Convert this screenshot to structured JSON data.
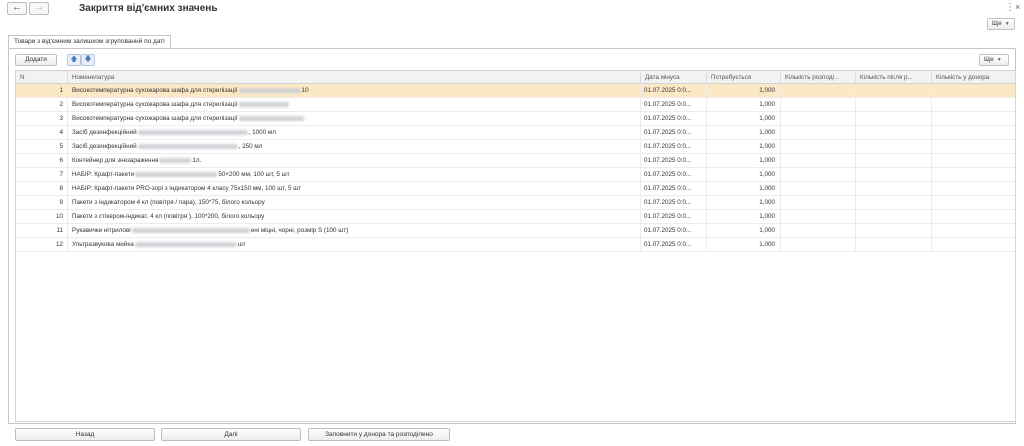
{
  "window": {
    "title": "Закриття від'ємних значень",
    "back_icon": "←",
    "forward_icon": "→",
    "kebab_icon": "⋮",
    "close_icon": "×"
  },
  "toolbar": {
    "more_label": "Ще"
  },
  "tab": {
    "label": "Товари з від'ємним залишком згрупований по даті"
  },
  "table_toolbar": {
    "add_label": "Додати",
    "up_icon": "🡅",
    "down_icon": "🡇",
    "more_label": "Ще"
  },
  "table": {
    "columns": {
      "n": "N",
      "name": "Номенклатура",
      "date": "Дата мінуса",
      "need": "Потребується",
      "k1": "Кількість розподі...",
      "k2": "Кількість після р...",
      "k3": "Кількість у донора"
    },
    "rows": [
      {
        "n": "1",
        "name_a": "Високотемпературна сухожарова шафа для стерилізації",
        "name_b": "10",
        "date": "01.07.2025 0:0...",
        "need": "1,000"
      },
      {
        "n": "2",
        "name_a": "Високотемпературна сухожарова шафа для стерилізації",
        "name_b": "",
        "date": "01.07.2025 0:0...",
        "need": "1,000"
      },
      {
        "n": "3",
        "name_a": "Високотемпературна сухожарова шафа для стерилізації",
        "name_b": "",
        "date": "01.07.2025 0:0...",
        "need": "1,000"
      },
      {
        "n": "4",
        "name_a": "Засіб дезинфекційний",
        "name_b": ", 1000 мл",
        "date": "01.07.2025 0:0...",
        "need": "1,000"
      },
      {
        "n": "5",
        "name_a": "Засіб дезинфекційний",
        "name_b": ", 250 мл",
        "date": "01.07.2025 0:0...",
        "need": "1,000"
      },
      {
        "n": "6",
        "name_a": "Контейнер для знезараження",
        "name_b": "1л.",
        "date": "01.07.2025 0:0...",
        "need": "1,000"
      },
      {
        "n": "7",
        "name_a": "НАБІР: Крафт-пакети",
        "name_b": "50×200 мм, 100 шт, 5 шт",
        "date": "01.07.2025 0:0...",
        "need": "1,000"
      },
      {
        "n": "8",
        "name_a": "НАБІР: Крафт-пакети PRO-зорі з індикатором 4 класу 75х150 мм, 100 шт, 5 шт",
        "name_b": "",
        "date": "01.07.2025 0:0...",
        "need": "1,000"
      },
      {
        "n": "9",
        "name_a": "Пакети з індикатором 4 кл (повітря / пара), 150*75, білого кольору",
        "name_b": "",
        "date": "01.07.2025 0:0...",
        "need": "1,000"
      },
      {
        "n": "10",
        "name_a": "Пакети з стікером-індикат. 4 кл (повітря ), 100*200, білого кольору",
        "name_b": "",
        "date": "01.07.2025 0:0...",
        "need": "1,000"
      },
      {
        "n": "11",
        "name_a": "Рукавички нітрилові",
        "name_b": "ені міцні, чорні, розмір S (100 шт)",
        "date": "01.07.2025 0:0...",
        "need": "1,000"
      },
      {
        "n": "12",
        "name_a": "Ультразвукова мийка",
        "name_b": "шт",
        "date": "01.07.2025 0:0...",
        "need": "1,000"
      }
    ]
  },
  "footer": {
    "back_label": "Назад",
    "next_label": "Далі",
    "fill_label": "Заповнити у донора та розподілено"
  },
  "colors": {
    "selected_row": "#fbe8c5",
    "accent": "#4a7bbd"
  }
}
